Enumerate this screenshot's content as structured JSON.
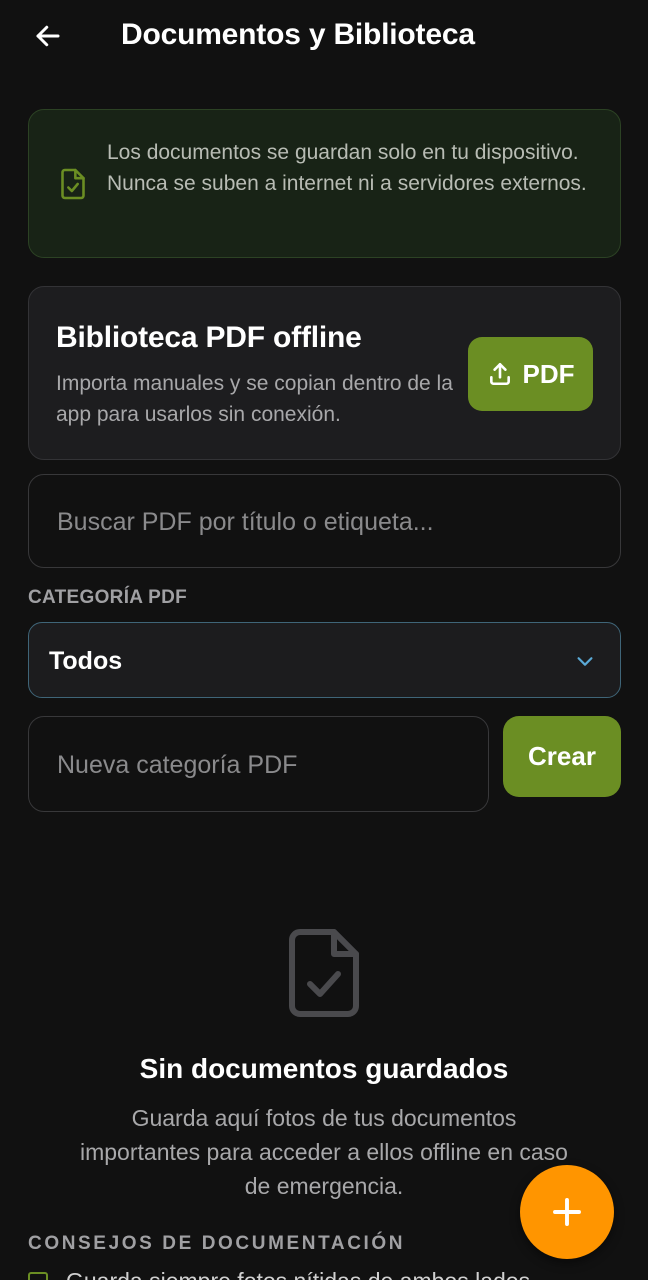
{
  "header": {
    "title": "Documentos y Biblioteca",
    "back_icon": "arrow-left-icon"
  },
  "privacy_banner": {
    "icon": "file-check-icon",
    "text": "Los documentos se guardan solo en tu dispositivo. Nunca se suben a internet ni a servidores externos."
  },
  "pdf_library": {
    "title": "Biblioteca PDF offline",
    "description": "Importa manuales y se copian dentro de la app para usarlos sin conexión.",
    "upload_button_icon": "upload-icon",
    "upload_button_label": "PDF"
  },
  "search": {
    "placeholder": "Buscar PDF por título o etiqueta...",
    "value": ""
  },
  "category": {
    "label": "CATEGORÍA PDF",
    "selected": "Todos",
    "dropdown_icon": "chevron-down-icon"
  },
  "new_category": {
    "placeholder": "Nueva categoría PDF",
    "value": "",
    "create_label": "Crear"
  },
  "empty_state": {
    "icon": "file-check-icon",
    "title": "Sin documentos guardados",
    "description": "Guarda aquí fotos de tus documentos importantes para acceder a ellos offline en caso de emergencia."
  },
  "tips": {
    "label": "CONSEJOS DE DOCUMENTACIÓN",
    "first_item_partial": "Guarda siempre fotos nítidas de ambos lados"
  },
  "fab": {
    "icon": "plus-icon"
  },
  "colors": {
    "background": "#111111",
    "accent_green": "#6b8e23",
    "fab_orange": "#ff9500",
    "banner_bg": "#182316",
    "select_border": "#3f6578"
  }
}
